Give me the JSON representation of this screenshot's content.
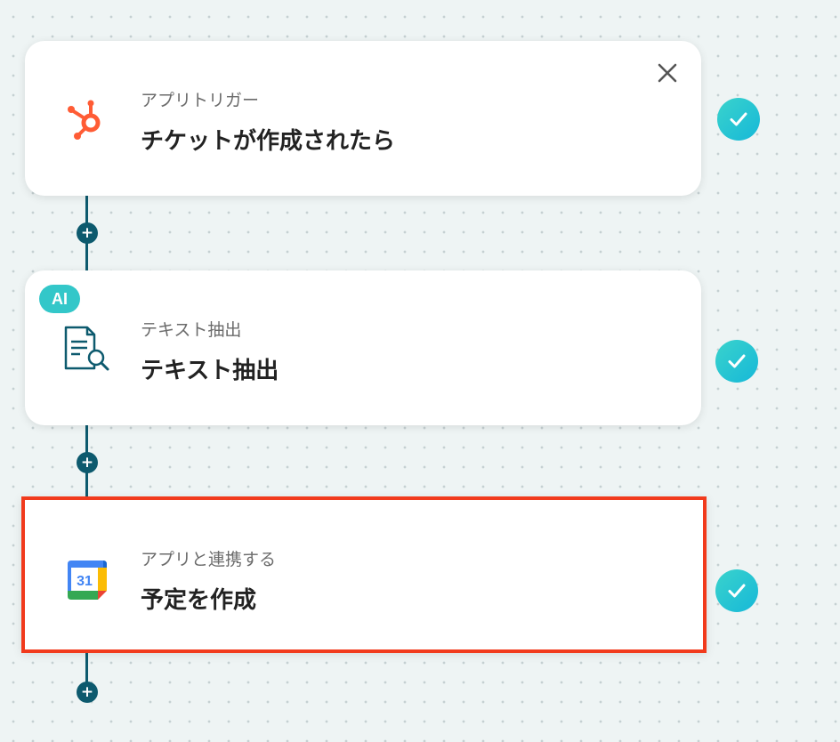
{
  "flow": {
    "steps": [
      {
        "kind_label": "アプリトリガー",
        "title": "チケットが作成されたら",
        "icon": "hubspot-icon",
        "status": "completed"
      },
      {
        "badge": "AI",
        "kind_label": "テキスト抽出",
        "title": "テキスト抽出",
        "icon": "document-search-icon",
        "status": "completed"
      },
      {
        "kind_label": "アプリと連携する",
        "title": "予定を作成",
        "icon": "google-calendar-icon",
        "calendar_day": "31",
        "status": "completed",
        "selected": true
      }
    ],
    "add_step_symbol": "+"
  },
  "colors": {
    "connector": "#0d5a6e",
    "check": "#26c6d6",
    "selection_border": "#f13a1c",
    "hubspot": "#ff5c35",
    "ai_badge": "#33c7c9"
  }
}
